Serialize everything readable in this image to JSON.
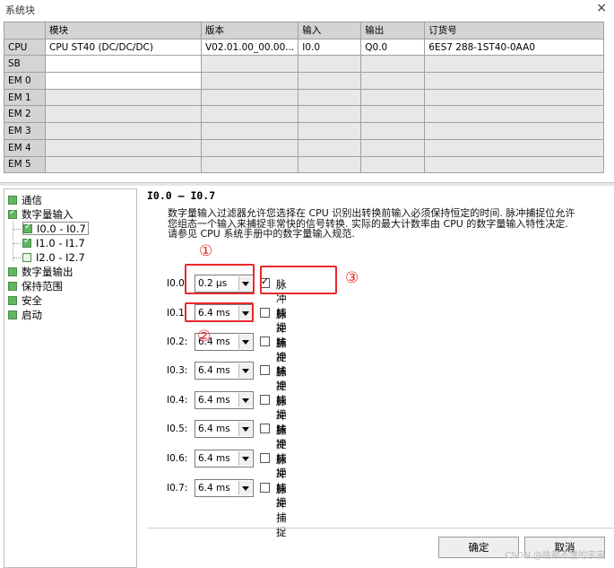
{
  "window": {
    "title": "系统块",
    "close_glyph": "×"
  },
  "module_table": {
    "headers": [
      "",
      "模块",
      "版本",
      "输入",
      "输出",
      "订货号"
    ],
    "rows": [
      {
        "slot": "CPU",
        "module": "CPU ST40 (DC/DC/DC)",
        "version": "V02.01.00_00.00...",
        "input": "I0.0",
        "output": "Q0.0",
        "order": "6ES7 288-1ST40-0AA0"
      },
      {
        "slot": "SB",
        "module": "",
        "version": "",
        "input": "",
        "output": "",
        "order": ""
      },
      {
        "slot": "EM 0",
        "module": "",
        "version": "",
        "input": "",
        "output": "",
        "order": ""
      },
      {
        "slot": "EM 1",
        "module": "",
        "version": "",
        "input": "",
        "output": "",
        "order": ""
      },
      {
        "slot": "EM 2",
        "module": "",
        "version": "",
        "input": "",
        "output": "",
        "order": ""
      },
      {
        "slot": "EM 3",
        "module": "",
        "version": "",
        "input": "",
        "output": "",
        "order": ""
      },
      {
        "slot": "EM 4",
        "module": "",
        "version": "",
        "input": "",
        "output": "",
        "order": ""
      },
      {
        "slot": "EM 5",
        "module": "",
        "version": "",
        "input": "",
        "output": "",
        "order": ""
      }
    ]
  },
  "tree": {
    "items": [
      {
        "label": "通信"
      },
      {
        "label": "数字量输入"
      },
      {
        "label": "I0.0 - I0.7"
      },
      {
        "label": "I1.0 - I1.7"
      },
      {
        "label": "I2.0 - I2.7"
      },
      {
        "label": "数字量输出"
      },
      {
        "label": "保持范围"
      },
      {
        "label": "安全"
      },
      {
        "label": "启动"
      }
    ]
  },
  "panel": {
    "heading": "I0.0 – I0.7",
    "description_lines": [
      "数字量输入过滤器允许您选择在 CPU 识别出转换前输入必须保持恒定的时间. 脉冲捕捉位允许",
      "您组态一个输入来捕捉非常快的信号转换. 实际的最大计数率由 CPU 的数字量输入特性决定.",
      "请参见 CPU 系统手册中的数字量输入规范."
    ],
    "pulse_label": "脉冲捕捉",
    "inputs": [
      {
        "label": "I0.0:",
        "filter": "0.2 μs",
        "pulse_capture": true
      },
      {
        "label": "I0.1:",
        "filter": "6.4 ms",
        "pulse_capture": false
      },
      {
        "label": "I0.2:",
        "filter": "6.4 ms",
        "pulse_capture": false
      },
      {
        "label": "I0.3:",
        "filter": "6.4 ms",
        "pulse_capture": false
      },
      {
        "label": "I0.4:",
        "filter": "6.4 ms",
        "pulse_capture": false
      },
      {
        "label": "I0.5:",
        "filter": "6.4 ms",
        "pulse_capture": false
      },
      {
        "label": "I0.6:",
        "filter": "6.4 ms",
        "pulse_capture": false
      },
      {
        "label": "I0.7:",
        "filter": "6.4 ms",
        "pulse_capture": false
      }
    ],
    "callouts": [
      "①",
      "②",
      "③"
    ]
  },
  "buttons": {
    "ok": "确定",
    "cancel": "取消"
  },
  "watermark": "CSDN @啥都不懂的宇宙",
  "colors": {
    "highlight": "#e8282b",
    "tree_box": "#5fb85f"
  }
}
